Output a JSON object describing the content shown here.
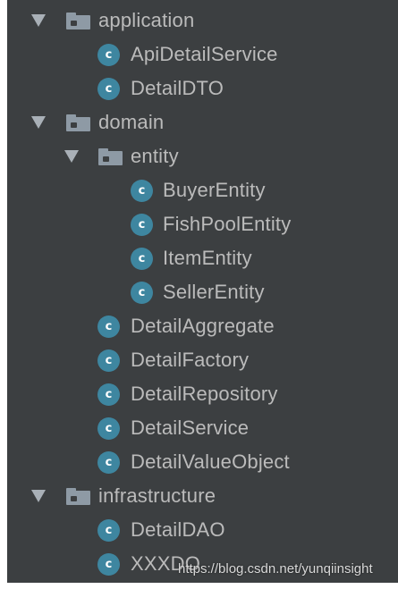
{
  "tree": {
    "application": {
      "label": "application",
      "children": [
        "ApiDetailService",
        "DetailDTO"
      ]
    },
    "domain": {
      "label": "domain",
      "entity": {
        "label": "entity",
        "children": [
          "BuyerEntity",
          "FishPoolEntity",
          "ItemEntity",
          "SellerEntity"
        ]
      },
      "children": [
        "DetailAggregate",
        "DetailFactory",
        "DetailRepository",
        "DetailService",
        "DetailValueObject"
      ]
    },
    "infrastructure": {
      "label": "infrastructure",
      "children": [
        "DetailDAO",
        "XXXDO"
      ]
    },
    "class_badge": "c",
    "icons": {
      "expand": "triangle-down-icon",
      "package": "folder-icon",
      "class": "class-c-icon"
    },
    "colors": {
      "background": "#3c3f41",
      "text": "#bbbbbb",
      "class_badge": "#3e86a0",
      "folder": "#8e9aa5",
      "arrow": "#a9b0b7"
    }
  },
  "watermark": "https://blog.csdn.net/yunqiinsight"
}
